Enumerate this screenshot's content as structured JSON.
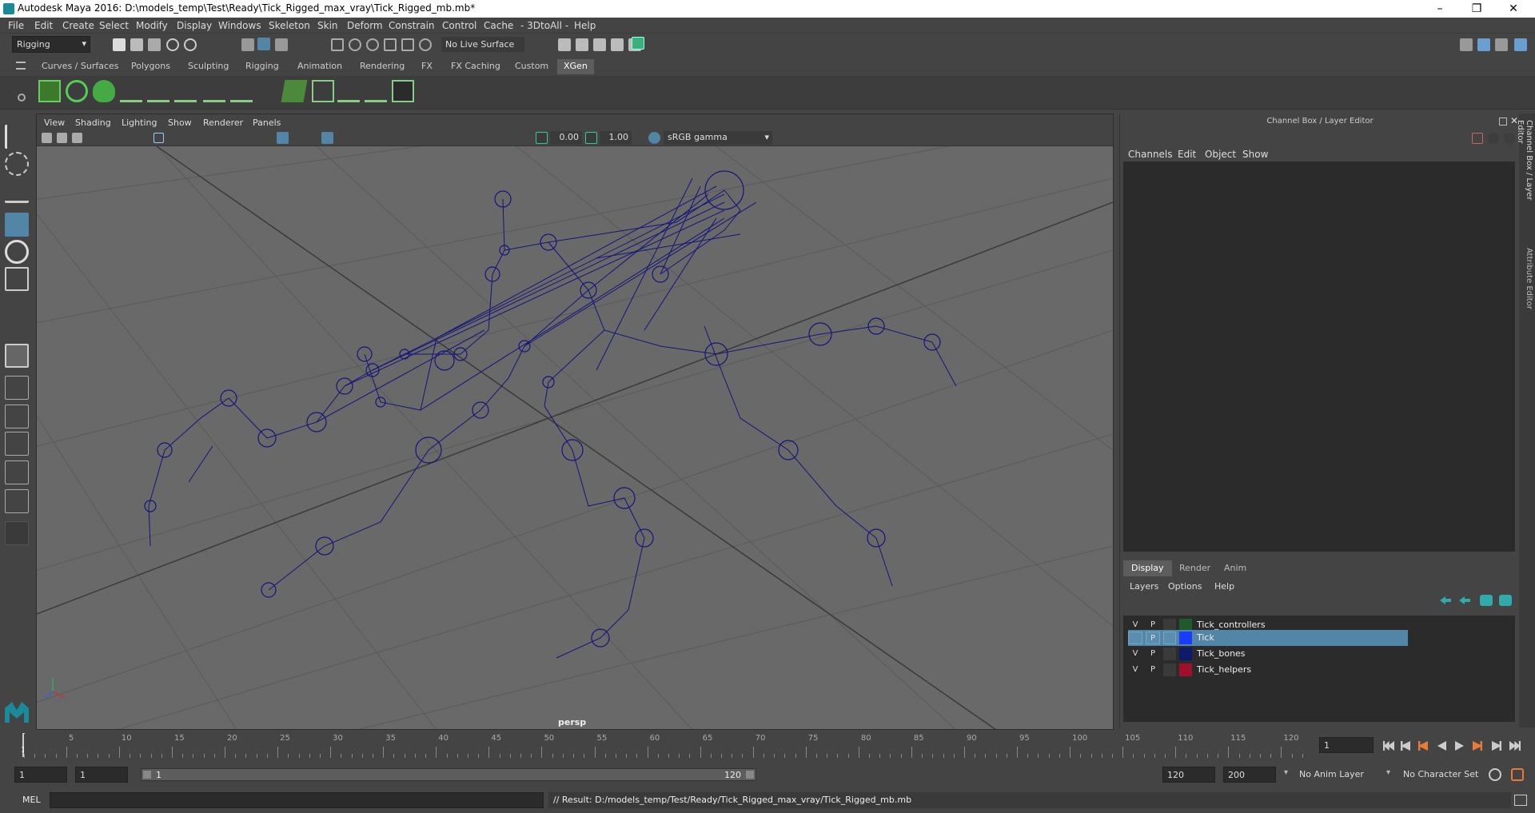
{
  "window": {
    "title": "Autodesk Maya 2016: D:\\models_temp\\Test\\Ready\\Tick_Rigged_max_vray\\Tick_Rigged_mb.mb*"
  },
  "menubar": [
    "File",
    "Edit",
    "Create",
    "Select",
    "Modify",
    "Display",
    "Windows",
    "Skeleton",
    "Skin",
    "Deform",
    "Constrain",
    "Control",
    "Cache",
    "- 3DtoAll -",
    "Help"
  ],
  "status": {
    "mode": "Rigging",
    "live_surface": "No Live Surface"
  },
  "shelf": {
    "tabs": [
      "Curves / Surfaces",
      "Polygons",
      "Sculpting",
      "Rigging",
      "Animation",
      "Rendering",
      "FX",
      "FX Caching",
      "Custom",
      "XGen"
    ],
    "active": "XGen"
  },
  "viewport": {
    "menus": [
      "View",
      "Shading",
      "Lighting",
      "Show",
      "Renderer",
      "Panels"
    ],
    "exposure": "0.00",
    "gamma": "1.00",
    "color_space": "sRGB gamma",
    "camera": "persp"
  },
  "channelbox": {
    "title": "Channel Box / Layer Editor",
    "menus": [
      "Channels",
      "Edit",
      "Object",
      "Show"
    ]
  },
  "layer_editor": {
    "tabs": [
      "Display",
      "Render",
      "Anim"
    ],
    "active": "Display",
    "menus": [
      "Layers",
      "Options",
      "Help"
    ],
    "layers": [
      {
        "v": "V",
        "p": "P",
        "name": "Tick_controllers",
        "color": "#1f5a2a",
        "selected": false
      },
      {
        "v": "",
        "p": "P",
        "name": "Tick",
        "color": "#1a3cff",
        "selected": true
      },
      {
        "v": "V",
        "p": "P",
        "name": "Tick_bones",
        "color": "#101a6a",
        "selected": false
      },
      {
        "v": "V",
        "p": "P",
        "name": "Tick_helpers",
        "color": "#a0102a",
        "selected": false
      }
    ]
  },
  "side_tabs": [
    "Channel Box / Layer Editor",
    "Attribute Editor"
  ],
  "timeline": {
    "ticks": [
      "5",
      "10",
      "15",
      "20",
      "25",
      "30",
      "35",
      "40",
      "45",
      "50",
      "55",
      "60",
      "65",
      "70",
      "75",
      "80",
      "85",
      "90",
      "95",
      "100",
      "105",
      "110",
      "115",
      "120"
    ],
    "start_marker": "1",
    "current_frame": "1"
  },
  "range": {
    "start": "1",
    "start2": "1",
    "slider_start": "1",
    "slider_end": "120",
    "end": "120",
    "end2": "200",
    "anim_layer": "No Anim Layer",
    "char_set": "No Character Set"
  },
  "cmd": {
    "lang": "MEL",
    "result": "// Result: D:/models_temp/Test/Ready/Tick_Rigged_max_vray/Tick_Rigged_mb.mb"
  }
}
